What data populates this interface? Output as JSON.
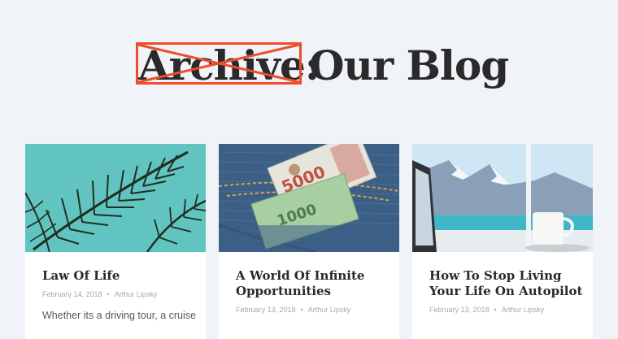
{
  "header": {
    "struck_word": "Archive:",
    "title": "Our Blog"
  },
  "posts": [
    {
      "title": "Law Of Life",
      "date": "February 14, 2018",
      "author": "Arthur Lipsky",
      "excerpt": "Whether its a driving tour, a cruise",
      "image": "palm-leaves-image"
    },
    {
      "title": "A World Of Infinite Opportunities",
      "date": "February 13, 2018",
      "author": "Arthur Lipsky",
      "image": "money-in-jeans-pocket-image"
    },
    {
      "title": "How To Stop Living Your Life On Autopilot",
      "date": "February 13, 2018",
      "author": "Arthur Lipsky",
      "image": "mountain-lake-coffee-image"
    }
  ],
  "colors": {
    "background": "#f0f4f8",
    "accent": "#ee4d2d",
    "title_text": "#2a2a2a",
    "meta_text": "#a3a9b0"
  },
  "meta_separator": "•"
}
